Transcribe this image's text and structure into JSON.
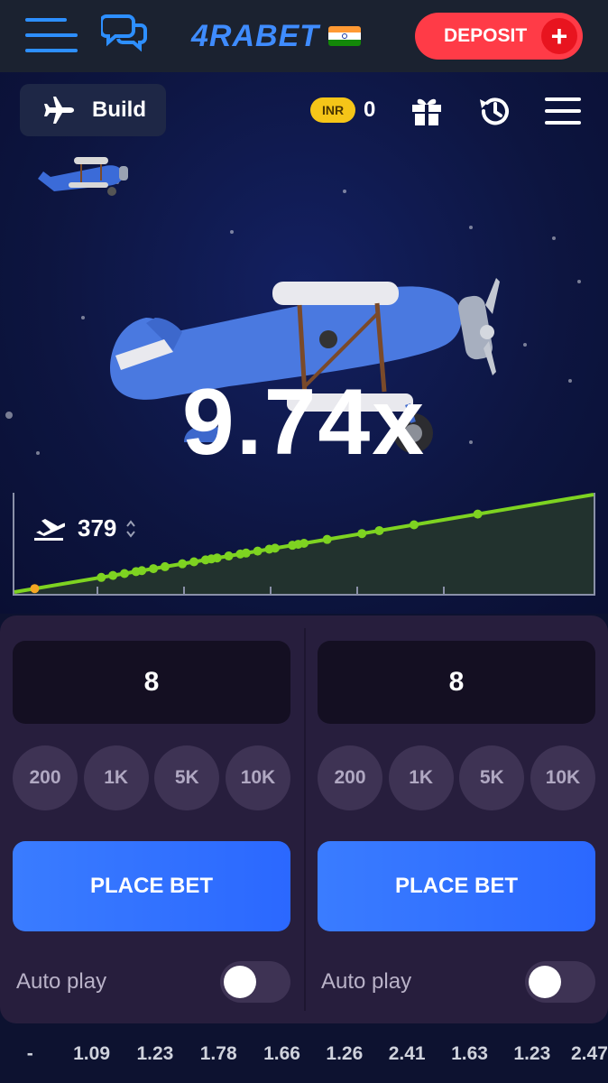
{
  "header": {
    "logo_text": "4RABET",
    "deposit_label": "DEPOSIT",
    "deposit_plus": "+"
  },
  "game": {
    "build_label": "Build",
    "currency": "INR",
    "balance": "0",
    "multiplier": "9.74x",
    "takeoff_count": "379",
    "colors": {
      "graph_line": "#7ed321",
      "graph_fill": "#22322e",
      "accent_blue": "#2d8fff"
    }
  },
  "bets": [
    {
      "amount": "8",
      "quick_amounts": [
        "200",
        "1K",
        "5K",
        "10K"
      ],
      "place_bet_label": "PLACE BET",
      "auto_play_label": "Auto play",
      "auto_play_on": false
    },
    {
      "amount": "8",
      "quick_amounts": [
        "200",
        "1K",
        "5K",
        "10K"
      ],
      "place_bet_label": "PLACE BET",
      "auto_play_label": "Auto play",
      "auto_play_on": false
    }
  ],
  "history": [
    "-",
    "1.09",
    "1.23",
    "1.78",
    "1.66",
    "1.26",
    "2.41",
    "1.63",
    "1.23",
    "2.47"
  ],
  "icons": [
    "hamburger-icon",
    "chat-icon",
    "india-flag-icon",
    "plane-icon",
    "gift-icon",
    "history-icon",
    "menu-icon",
    "takeoff-icon",
    "sort-icon"
  ]
}
